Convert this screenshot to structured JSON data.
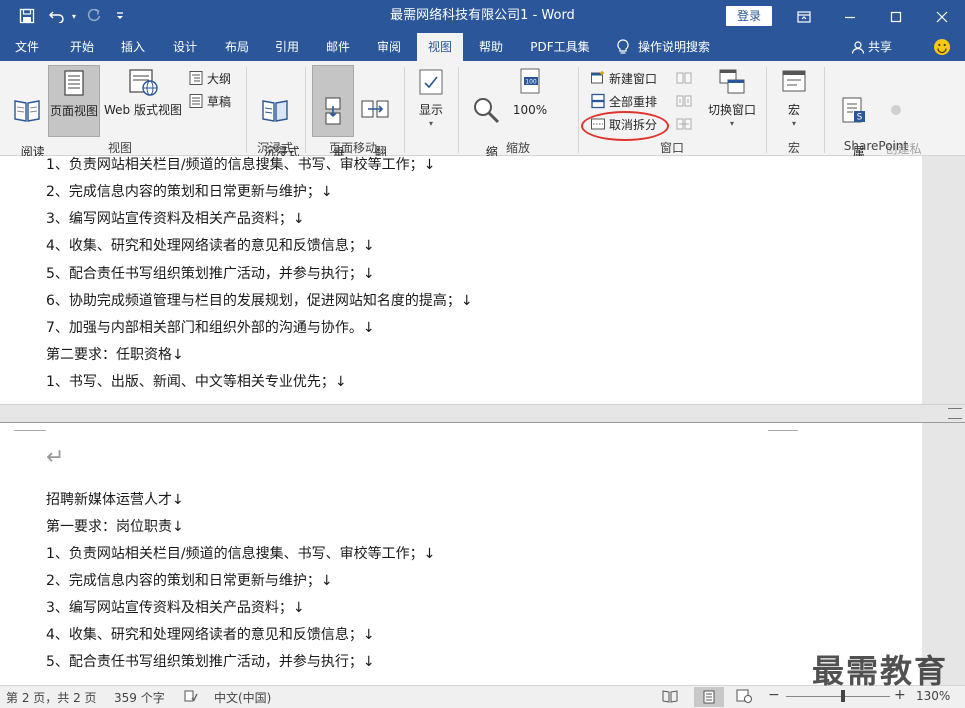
{
  "window": {
    "title": "最需网络科技有限公司1  -  Word",
    "login": "登录"
  },
  "tabs": [
    {
      "label": "文件"
    },
    {
      "label": "开始"
    },
    {
      "label": "插入"
    },
    {
      "label": "设计"
    },
    {
      "label": "布局"
    },
    {
      "label": "引用"
    },
    {
      "label": "邮件"
    },
    {
      "label": "审阅"
    },
    {
      "label": "视图"
    },
    {
      "label": "帮助"
    },
    {
      "label": "PDF工具集"
    },
    {
      "label": "操作说明搜索"
    },
    {
      "label": "共享"
    }
  ],
  "ribbon": {
    "view": {
      "read": "阅读\n视图",
      "page": "页面视图",
      "web": "Web 版式视图",
      "outline": "大纲",
      "draft": "草稿",
      "group": "视图"
    },
    "immersive": {
      "reader": "沉浸式\n阅读器",
      "group": "沉浸式"
    },
    "pagemove": {
      "vertical": "垂\n直",
      "flip": "翻\n页",
      "group": "页面移动"
    },
    "show": {
      "label": "显示"
    },
    "zoom": {
      "zoom": "缩\n放",
      "pct": "100%",
      "group": "缩放"
    },
    "window": {
      "new": "新建窗口",
      "arrange": "全部重排",
      "unsplit": "取消拆分",
      "switch": "切换窗口",
      "group": "窗口"
    },
    "macro": {
      "label": "宏",
      "group": "宏"
    },
    "sp": {
      "props": "属\n性",
      "private": "创建私\n人副本",
      "group": "SharePoint"
    }
  },
  "doc_top": [
    "1、负责网站相关栏目/频道的信息搜集、书写、审校等工作；↓",
    "2、完成信息内容的策划和日常更新与维护；↓",
    "3、编写网站宣传资料及相关产品资料；↓",
    "4、收集、研究和处理网络读者的意见和反馈信息；↓",
    "5、配合责任书写组织策划推广活动，并参与执行；↓",
    "6、协助完成频道管理与栏目的发展规划，促进网站知名度的提高；↓",
    "7、加强与内部相关部门和组织外部的沟通与协作。↓",
    "第二要求：任职资格↓",
    "1、书写、出版、新闻、中文等相关专业优先；↓"
  ],
  "doc_bottom": [
    "↵",
    "招聘新媒体运营人才↓",
    "第一要求：岗位职责↓",
    "1、负责网站相关栏目/频道的信息搜集、书写、审校等工作；↓",
    "2、完成信息内容的策划和日常更新与维护；↓",
    "3、编写网站宣传资料及相关产品资料；↓",
    "4、收集、研究和处理网络读者的意见和反馈信息；↓",
    "5、配合责任书写组织策划推广活动，并参与执行；↓"
  ],
  "status": {
    "page": "第 2 页，共 2 页",
    "words": "359 个字",
    "lang": "中文(中国)",
    "zoom": "130%"
  },
  "watermark": "最需教育",
  "colors": {
    "accent": "#2b579a",
    "highlight": "#e0342c"
  }
}
